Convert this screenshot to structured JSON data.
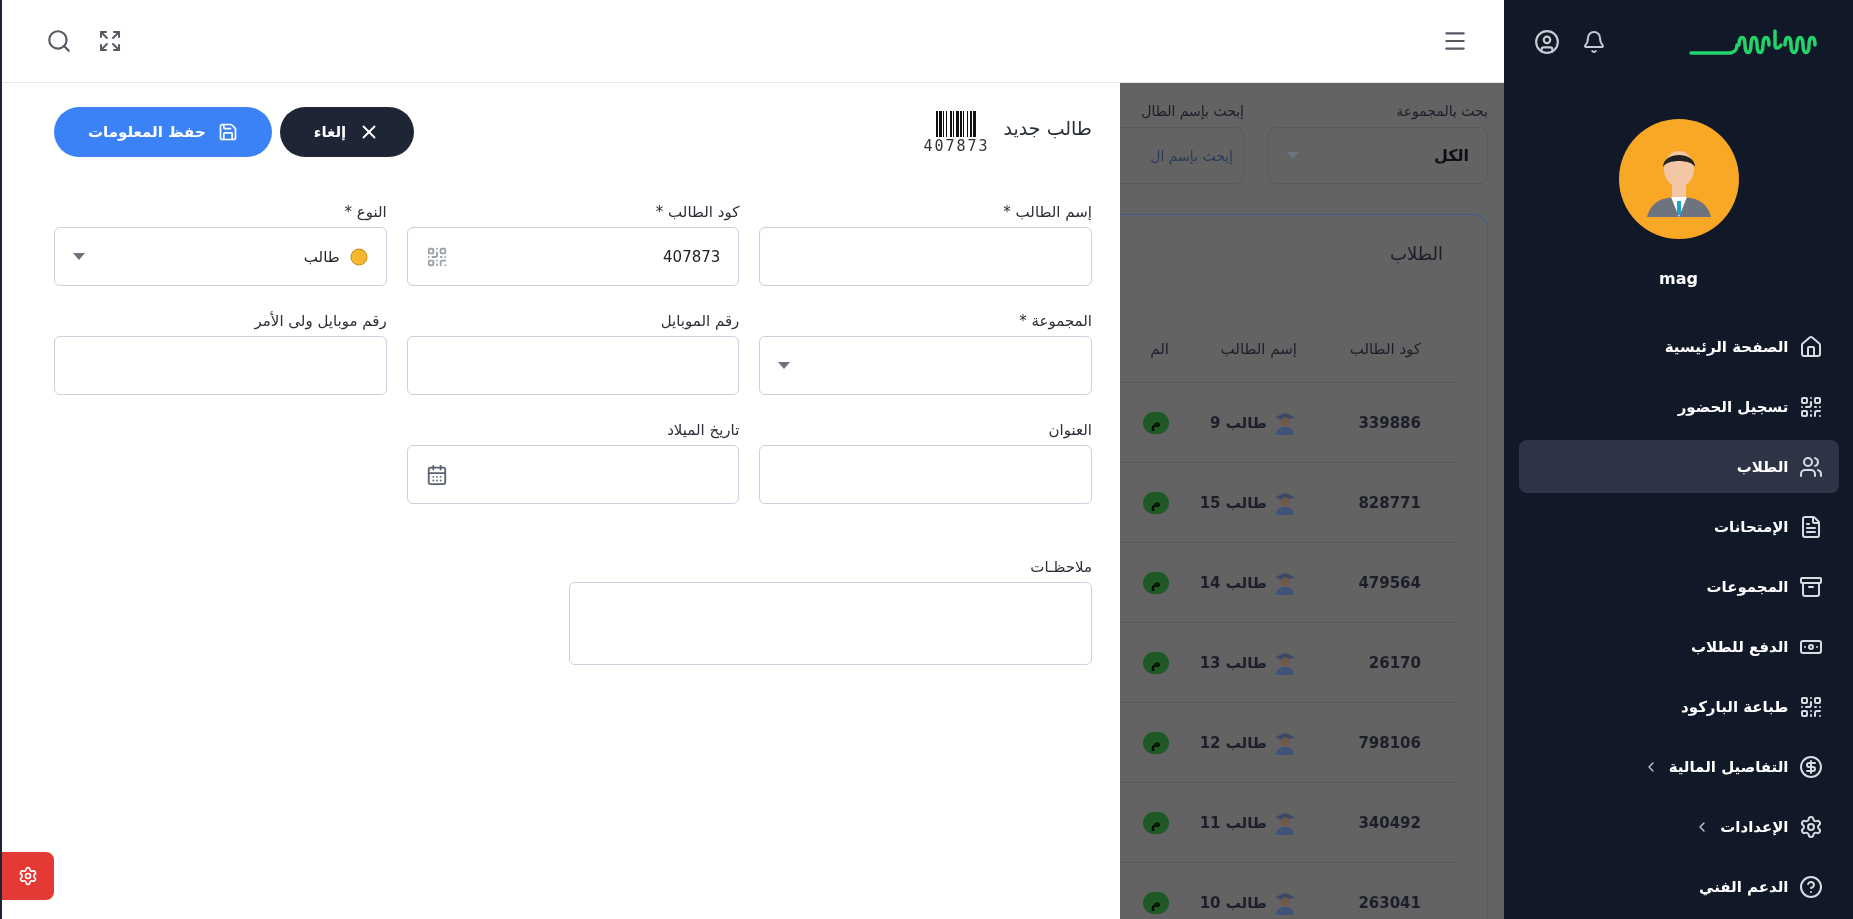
{
  "sidebar": {
    "user": {
      "name": "mag"
    },
    "items": [
      {
        "label": "الصفحة الرئيسية",
        "selected": false,
        "expandable": false
      },
      {
        "label": "تسجيل الحضور",
        "selected": false,
        "expandable": false
      },
      {
        "label": "الطلاب",
        "selected": true,
        "expandable": false
      },
      {
        "label": "الإمتحانات",
        "selected": false,
        "expandable": false
      },
      {
        "label": "المجموعات",
        "selected": false,
        "expandable": false
      },
      {
        "label": "الدفع للطلاب",
        "selected": false,
        "expandable": false
      },
      {
        "label": "طباعة الباركود",
        "selected": false,
        "expandable": false
      },
      {
        "label": "التفاصيل المالية",
        "selected": false,
        "expandable": true
      },
      {
        "label": "الإعدادات",
        "selected": false,
        "expandable": true
      },
      {
        "label": "الدعم الفني",
        "selected": false,
        "expandable": false
      }
    ]
  },
  "background_page": {
    "filters": [
      {
        "label": "بحث بالمجموعة",
        "value": "الكل",
        "kind": "select"
      },
      {
        "label": "إبحث بإسم الطال",
        "placeholder": "إبحث بإسم ال",
        "kind": "text"
      }
    ],
    "table": {
      "title": "الطلاب",
      "columns": [
        "كود الطالب",
        "إسم الطالب",
        "الم"
      ],
      "rows": [
        {
          "code": "339886",
          "name": "طالب 9",
          "badge": "م"
        },
        {
          "code": "828771",
          "name": "طالب 15",
          "badge": "م"
        },
        {
          "code": "479564",
          "name": "طالب 14",
          "badge": "م"
        },
        {
          "code": "26170",
          "name": "طالب 13",
          "badge": "م"
        },
        {
          "code": "798106",
          "name": "طالب 12",
          "badge": "م"
        },
        {
          "code": "340492",
          "name": "طالب 11",
          "badge": "م"
        },
        {
          "code": "263041",
          "name": "طالب 10",
          "badge": "م"
        }
      ]
    }
  },
  "drawer": {
    "title": "طالب جديد",
    "code": "407873",
    "buttons": [
      {
        "kind": "cancel",
        "label": "إلغاء"
      },
      {
        "kind": "save",
        "label": "حفظ المعلومات"
      }
    ],
    "fields": [
      {
        "label": "إسم الطالب *",
        "kind": "text"
      },
      {
        "label": "كود الطالب *",
        "kind": "code",
        "value": "407873"
      },
      {
        "label": "النوع *",
        "kind": "select",
        "value": "طالب"
      },
      {
        "label": "المجموعة *",
        "kind": "select"
      },
      {
        "label": "رقم الموبايل",
        "kind": "text"
      },
      {
        "label": "رقم موبايل ولى الأمر",
        "kind": "text"
      },
      {
        "label": "العنوان",
        "kind": "text"
      },
      {
        "label": "تاريخ الميلاد",
        "kind": "date"
      }
    ],
    "notes": {
      "label": "ملاحظـات"
    }
  }
}
